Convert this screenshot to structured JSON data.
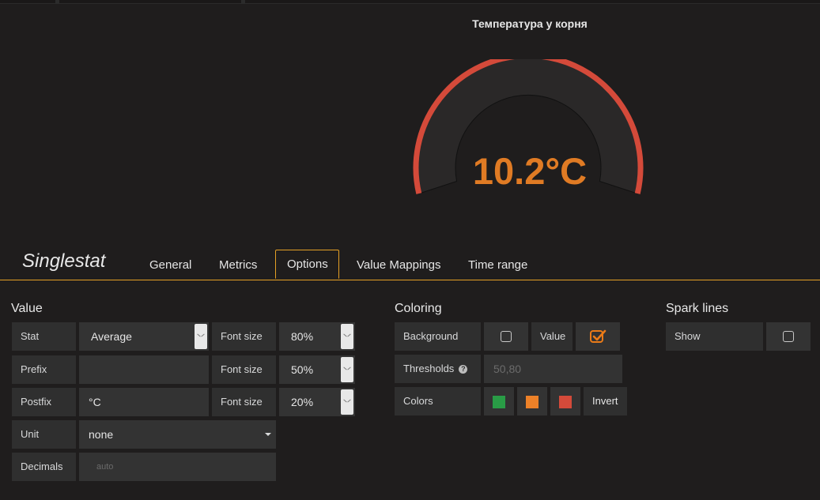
{
  "panel": {
    "title": "Температура у корня",
    "value": "10.2°C",
    "gauge_fraction": 1.0,
    "colors": {
      "arc": "#d44a3a",
      "value_text": "#e07b24",
      "gauge_bg": "#2a2828"
    }
  },
  "editor": {
    "title": "Singlestat",
    "tabs": [
      {
        "label": "General",
        "active": false
      },
      {
        "label": "Metrics",
        "active": false
      },
      {
        "label": "Options",
        "active": true
      },
      {
        "label": "Value Mappings",
        "active": false
      },
      {
        "label": "Time range",
        "active": false
      }
    ],
    "accent": "#e5a025"
  },
  "value_section": {
    "title": "Value",
    "stat_label": "Stat",
    "stat_value": "Average",
    "prefix_label": "Prefix",
    "prefix_value": "",
    "postfix_label": "Postfix",
    "postfix_value": "°C",
    "font_size_label": "Font size",
    "font_size_value": "80%",
    "prefix_font_size_value": "50%",
    "postfix_font_size_value": "20%",
    "unit_label": "Unit",
    "unit_value": "none",
    "decimals_label": "Decimals",
    "decimals_placeholder": "auto"
  },
  "coloring": {
    "title": "Coloring",
    "background_label": "Background",
    "background_checked": false,
    "value_label": "Value",
    "value_checked": true,
    "thresholds_label": "Thresholds",
    "thresholds_placeholder": "50,80",
    "colors_label": "Colors",
    "color_swatches": [
      "#299c46",
      "#ed8128",
      "#d44a3a"
    ],
    "invert_label": "Invert"
  },
  "spark_lines": {
    "title": "Spark lines",
    "show_label": "Show",
    "show_checked": false
  }
}
